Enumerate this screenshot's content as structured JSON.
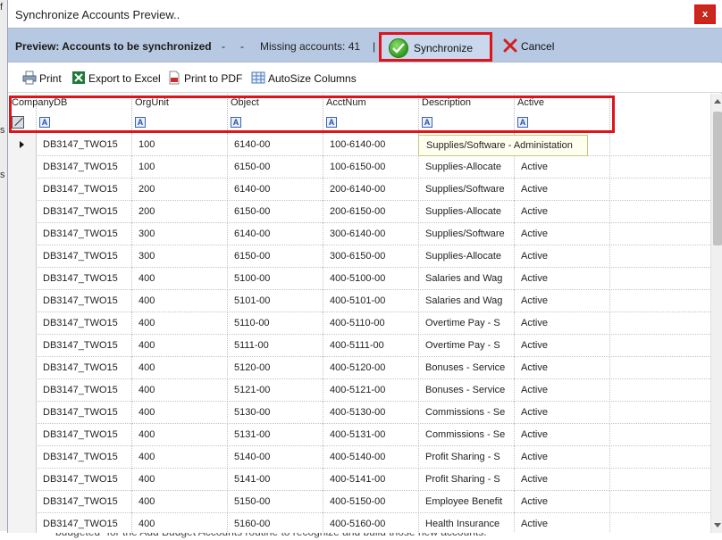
{
  "background": {
    "left_fragments": [
      "f",
      "s",
      "s"
    ],
    "bottom_text": "budgeted\" for the Add Budget Accounts routine to recognize and build those new accounts."
  },
  "window": {
    "title": "Synchronize Accounts Preview..",
    "close_label": "x"
  },
  "preview_bar": {
    "heading": "Preview: Accounts to be synchronized",
    "sep1": "-",
    "sep2": "-",
    "missing_text": "Missing accounts: 41",
    "pipe": "|",
    "synchronize_label": "Synchronize",
    "cancel_label": "Cancel"
  },
  "toolbar": {
    "print_label": "Print",
    "excel_label": "Export to Excel",
    "pdf_label": "Print to PDF",
    "autosize_label": "AutoSize Columns"
  },
  "grid": {
    "columns": [
      "CompanyDB",
      "OrgUnit",
      "Object",
      "AcctNum",
      "Description",
      "Active"
    ],
    "filter_glyph": "A",
    "tooltip": "Supplies/Software - Administation",
    "rows": [
      {
        "company": "DB3147_TWO15",
        "org": "100",
        "object": "6140-00",
        "acct": "100-6140-00",
        "desc": "",
        "active": ""
      },
      {
        "company": "DB3147_TWO15",
        "org": "100",
        "object": "6150-00",
        "acct": "100-6150-00",
        "desc": "Supplies-Allocate",
        "active": "Active"
      },
      {
        "company": "DB3147_TWO15",
        "org": "200",
        "object": "6140-00",
        "acct": "200-6140-00",
        "desc": "Supplies/Software",
        "active": "Active"
      },
      {
        "company": "DB3147_TWO15",
        "org": "200",
        "object": "6150-00",
        "acct": "200-6150-00",
        "desc": "Supplies-Allocate",
        "active": "Active"
      },
      {
        "company": "DB3147_TWO15",
        "org": "300",
        "object": "6140-00",
        "acct": "300-6140-00",
        "desc": "Supplies/Software",
        "active": "Active"
      },
      {
        "company": "DB3147_TWO15",
        "org": "300",
        "object": "6150-00",
        "acct": "300-6150-00",
        "desc": "Supplies-Allocate",
        "active": "Active"
      },
      {
        "company": "DB3147_TWO15",
        "org": "400",
        "object": "5100-00",
        "acct": "400-5100-00",
        "desc": "Salaries and Wag",
        "active": "Active"
      },
      {
        "company": "DB3147_TWO15",
        "org": "400",
        "object": "5101-00",
        "acct": "400-5101-00",
        "desc": "Salaries and Wag",
        "active": "Active"
      },
      {
        "company": "DB3147_TWO15",
        "org": "400",
        "object": "5110-00",
        "acct": "400-5110-00",
        "desc": "Overtime Pay - S",
        "active": "Active"
      },
      {
        "company": "DB3147_TWO15",
        "org": "400",
        "object": "5111-00",
        "acct": "400-5111-00",
        "desc": "Overtime Pay - S",
        "active": "Active"
      },
      {
        "company": "DB3147_TWO15",
        "org": "400",
        "object": "5120-00",
        "acct": "400-5120-00",
        "desc": "Bonuses - Service",
        "active": "Active"
      },
      {
        "company": "DB3147_TWO15",
        "org": "400",
        "object": "5121-00",
        "acct": "400-5121-00",
        "desc": "Bonuses - Service",
        "active": "Active"
      },
      {
        "company": "DB3147_TWO15",
        "org": "400",
        "object": "5130-00",
        "acct": "400-5130-00",
        "desc": "Commissions - Se",
        "active": "Active"
      },
      {
        "company": "DB3147_TWO15",
        "org": "400",
        "object": "5131-00",
        "acct": "400-5131-00",
        "desc": "Commissions - Se",
        "active": "Active"
      },
      {
        "company": "DB3147_TWO15",
        "org": "400",
        "object": "5140-00",
        "acct": "400-5140-00",
        "desc": "Profit Sharing - S",
        "active": "Active"
      },
      {
        "company": "DB3147_TWO15",
        "org": "400",
        "object": "5141-00",
        "acct": "400-5141-00",
        "desc": "Profit Sharing - S",
        "active": "Active"
      },
      {
        "company": "DB3147_TWO15",
        "org": "400",
        "object": "5150-00",
        "acct": "400-5150-00",
        "desc": "Employee Benefit",
        "active": "Active"
      },
      {
        "company": "DB3147_TWO15",
        "org": "400",
        "object": "5160-00",
        "acct": "400-5160-00",
        "desc": "Health Insurance",
        "active": "Active"
      }
    ]
  },
  "colors": {
    "highlight_outline": "#e0121a",
    "preview_bar": "#b7c9e2"
  }
}
